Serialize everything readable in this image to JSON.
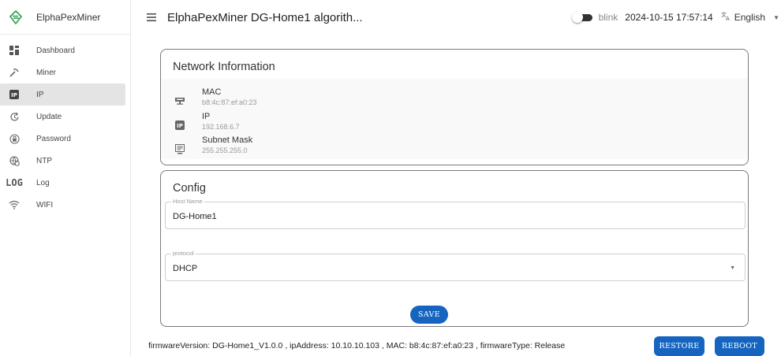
{
  "app": {
    "brand": "ElphaPexMiner",
    "title": "ElphaPexMiner DG-Home1 algorith...",
    "accent": "#1565c0",
    "brand_green": "#2e9d4f"
  },
  "header": {
    "blink_label": "blink",
    "blink_on": false,
    "datetime": "2024-10-15 17:57:14",
    "language": "English"
  },
  "sidebar": {
    "items": [
      {
        "label": "Dashboard",
        "icon": "dashboard-icon"
      },
      {
        "label": "Miner",
        "icon": "pickaxe-icon"
      },
      {
        "label": "IP",
        "icon": "ip-icon",
        "active": true
      },
      {
        "label": "Update",
        "icon": "update-icon"
      },
      {
        "label": "Password",
        "icon": "lock-icon"
      },
      {
        "label": "NTP",
        "icon": "globe-clock-icon"
      },
      {
        "label": "Log",
        "icon": "log-icon",
        "icon_text": "LOG"
      },
      {
        "label": "WIFI",
        "icon": "wifi-icon"
      }
    ]
  },
  "network": {
    "title": "Network Information",
    "rows": [
      {
        "label": "MAC",
        "value": "b8:4c:87:ef:a0:23",
        "icon": "lan-icon"
      },
      {
        "label": "IP",
        "value": "192.168.6.7",
        "icon": "ip-icon"
      },
      {
        "label": "Subnet Mask",
        "value": "255.255.255.0",
        "icon": "subnet-icon"
      }
    ]
  },
  "config": {
    "title": "Config",
    "host_name_label": "Host Name",
    "host_name_value": "DG-Home1",
    "protocol_label": "protocol",
    "protocol_value": "DHCP",
    "save_label": "SAVE"
  },
  "footer": {
    "info": "firmwareVersion: DG-Home1_V1.0.0 , ipAddress: 10.10.10.103 , MAC: b8:4c:87:ef:a0:23 , firmwareType: Release",
    "restore_label": "RESTORE",
    "reboot_label": "REBOOT"
  }
}
